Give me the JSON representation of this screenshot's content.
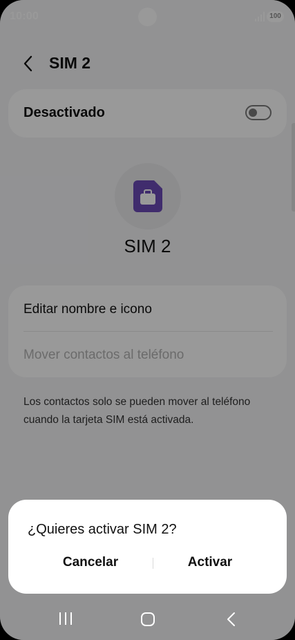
{
  "status_bar": {
    "time": "10:00",
    "battery": "100",
    "icons": [
      "camera-punch-hole",
      "signal-icon",
      "battery-icon"
    ]
  },
  "header": {
    "back_icon": "chevron-left-icon",
    "title": "SIM 2"
  },
  "toggle": {
    "label": "Desactivado",
    "state": "off"
  },
  "sim": {
    "icon": "sim-card-briefcase-icon",
    "icon_color": "#6c4ab6",
    "name": "SIM 2"
  },
  "options": {
    "items": [
      {
        "label": "Editar nombre e icono",
        "enabled": true
      },
      {
        "label": "Mover contactos al teléfono",
        "enabled": false
      }
    ]
  },
  "info": {
    "text": "Los contactos solo se pueden mover al teléfono cuando la tarjeta SIM está activada."
  },
  "dialog": {
    "title": "¿Quieres activar SIM 2?",
    "cancel_label": "Cancelar",
    "confirm_label": "Activar"
  },
  "nav_bar": {
    "icons": [
      "recents-icon",
      "home-icon",
      "back-icon"
    ]
  }
}
